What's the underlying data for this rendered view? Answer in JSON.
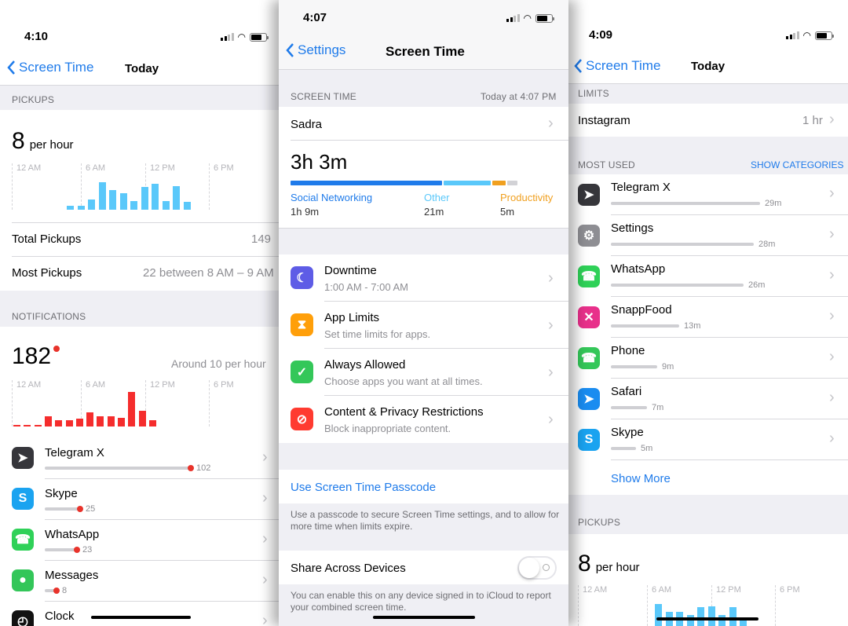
{
  "left": {
    "time": "4:10",
    "back": "Screen Time",
    "title": "Today",
    "pickups": {
      "header": "PICKUPS",
      "rate_num": "8",
      "rate_unit": "per hour",
      "axis": [
        "12 AM",
        "6 AM",
        "12 PM",
        "6 PM"
      ],
      "bars": [
        0.13,
        0.13,
        0.32,
        0.83,
        0.6,
        0.5,
        0.26,
        0.7,
        0.79,
        0.27,
        0.72,
        0.24
      ],
      "rows": [
        {
          "label": "Total Pickups",
          "value": "149"
        },
        {
          "label": "Most Pickups",
          "value": "22 between 8 AM – 9 AM"
        }
      ]
    },
    "notifications": {
      "header": "NOTIFICATIONS",
      "count": "182",
      "rate": "Around 10 per hour",
      "axis": [
        "12 AM",
        "6 AM",
        "12 PM",
        "6 PM"
      ],
      "bars": [
        0.04,
        0.04,
        0.04,
        0.25,
        0.15,
        0.15,
        0.2,
        0.35,
        0.25,
        0.25,
        0.22,
        0.88,
        0.4,
        0.15
      ],
      "apps": [
        {
          "name": "Telegram X",
          "count": "102",
          "fraction": 1.0,
          "icon": "telegram-icon",
          "color": "#36363b"
        },
        {
          "name": "Skype",
          "count": "25",
          "fraction": 0.24,
          "icon": "skype-icon",
          "color": "#1aa3f0"
        },
        {
          "name": "WhatsApp",
          "count": "23",
          "fraction": 0.22,
          "icon": "whatsapp-icon",
          "color": "#2fd158"
        },
        {
          "name": "Messages",
          "count": "8",
          "fraction": 0.08,
          "icon": "messages-icon",
          "color": "#33c659"
        },
        {
          "name": "Clock",
          "count": "",
          "fraction": 0,
          "icon": "clock-icon",
          "color": "#111111"
        }
      ]
    }
  },
  "center": {
    "time": "4:07",
    "back": "Settings",
    "title": "Screen Time",
    "section": "SCREEN TIME",
    "updated": "Today at 4:07 PM",
    "user": "Sadra",
    "total": "3h 3m",
    "categories": [
      {
        "name": "Social Networking",
        "time": "1h 9m",
        "color": "#1f7bea",
        "share": 0.58
      },
      {
        "name": "Other",
        "time": "21m",
        "color": "#5ac8fa",
        "share": 0.18
      },
      {
        "name": "Productivity",
        "time": "5m",
        "color": "#f0a020",
        "share": 0.05
      },
      {
        "name": "",
        "time": "",
        "color": "#d2d2d6",
        "share": 0.04
      }
    ],
    "menu": [
      {
        "title": "Downtime",
        "subtitle": "1:00 AM - 7:00 AM",
        "icon": "downtime-icon",
        "color": "#5e5ce6"
      },
      {
        "title": "App Limits",
        "subtitle": "Set time limits for apps.",
        "icon": "hourglass-icon",
        "color": "#ff9f0a"
      },
      {
        "title": "Always Allowed",
        "subtitle": "Choose apps you want at all times.",
        "icon": "checkmark-badge-icon",
        "color": "#34c759"
      },
      {
        "title": "Content & Privacy Restrictions",
        "subtitle": "Block inappropriate content.",
        "icon": "restriction-icon",
        "color": "#ff3b30"
      }
    ],
    "passcode": {
      "label": "Use Screen Time Passcode",
      "footer": "Use a passcode to secure Screen Time settings, and to allow for more time when limits expire."
    },
    "share": {
      "label": "Share Across Devices",
      "footer": "You can enable this on any device signed in to iCloud to report your combined screen time."
    }
  },
  "right": {
    "time": "4:09",
    "back": "Screen Time",
    "title": "Today",
    "limits": {
      "header": "LIMITS",
      "app": "Instagram",
      "value": "1 hr"
    },
    "most_used": {
      "header": "MOST USED",
      "action": "SHOW CATEGORIES",
      "apps": [
        {
          "name": "Telegram X",
          "time": "29m",
          "fraction": 1.0,
          "icon": "telegram-icon",
          "color": "#36363b"
        },
        {
          "name": "Settings",
          "time": "28m",
          "fraction": 0.96,
          "icon": "settings-icon",
          "color": "#8e8e93"
        },
        {
          "name": "WhatsApp",
          "time": "26m",
          "fraction": 0.89,
          "icon": "whatsapp-icon",
          "color": "#2fd158"
        },
        {
          "name": "SnappFood",
          "time": "13m",
          "fraction": 0.46,
          "icon": "snappfood-icon",
          "color": "#e8308a"
        },
        {
          "name": "Phone",
          "time": "9m",
          "fraction": 0.31,
          "icon": "phone-icon",
          "color": "#34c759"
        },
        {
          "name": "Safari",
          "time": "7m",
          "fraction": 0.24,
          "icon": "safari-icon",
          "color": "#1a8cf0"
        },
        {
          "name": "Skype",
          "time": "5m",
          "fraction": 0.17,
          "icon": "skype-icon",
          "color": "#1aa3f0"
        }
      ],
      "show_more": "Show More"
    },
    "pickups": {
      "header": "PICKUPS",
      "rate_num": "8",
      "rate_unit": "per hour",
      "axis": [
        "12 AM",
        "6 AM",
        "12 PM",
        "6 PM"
      ],
      "bars": [
        0.7,
        0.45,
        0.45,
        0.35,
        0.6,
        0.62,
        0.35,
        0.6,
        0.28
      ]
    }
  }
}
